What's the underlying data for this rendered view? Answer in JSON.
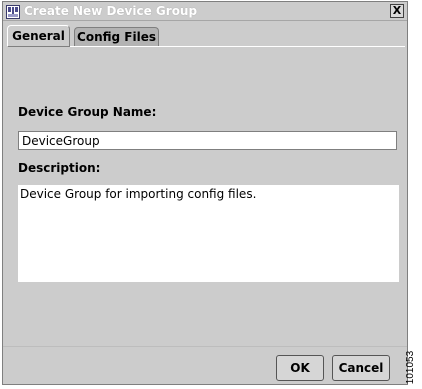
{
  "window": {
    "title": "Create New Device Group",
    "close_label": "X"
  },
  "tabs": [
    {
      "label": "General",
      "active": true
    },
    {
      "label": "Config Files",
      "active": false
    }
  ],
  "form": {
    "name_label": "Device Group Name:",
    "name_value": "DeviceGroup",
    "description_label": "Description:",
    "description_value": "Device Group for importing config files."
  },
  "buttons": {
    "ok_label": "OK",
    "cancel_label": "Cancel"
  },
  "figure_id": "101053"
}
